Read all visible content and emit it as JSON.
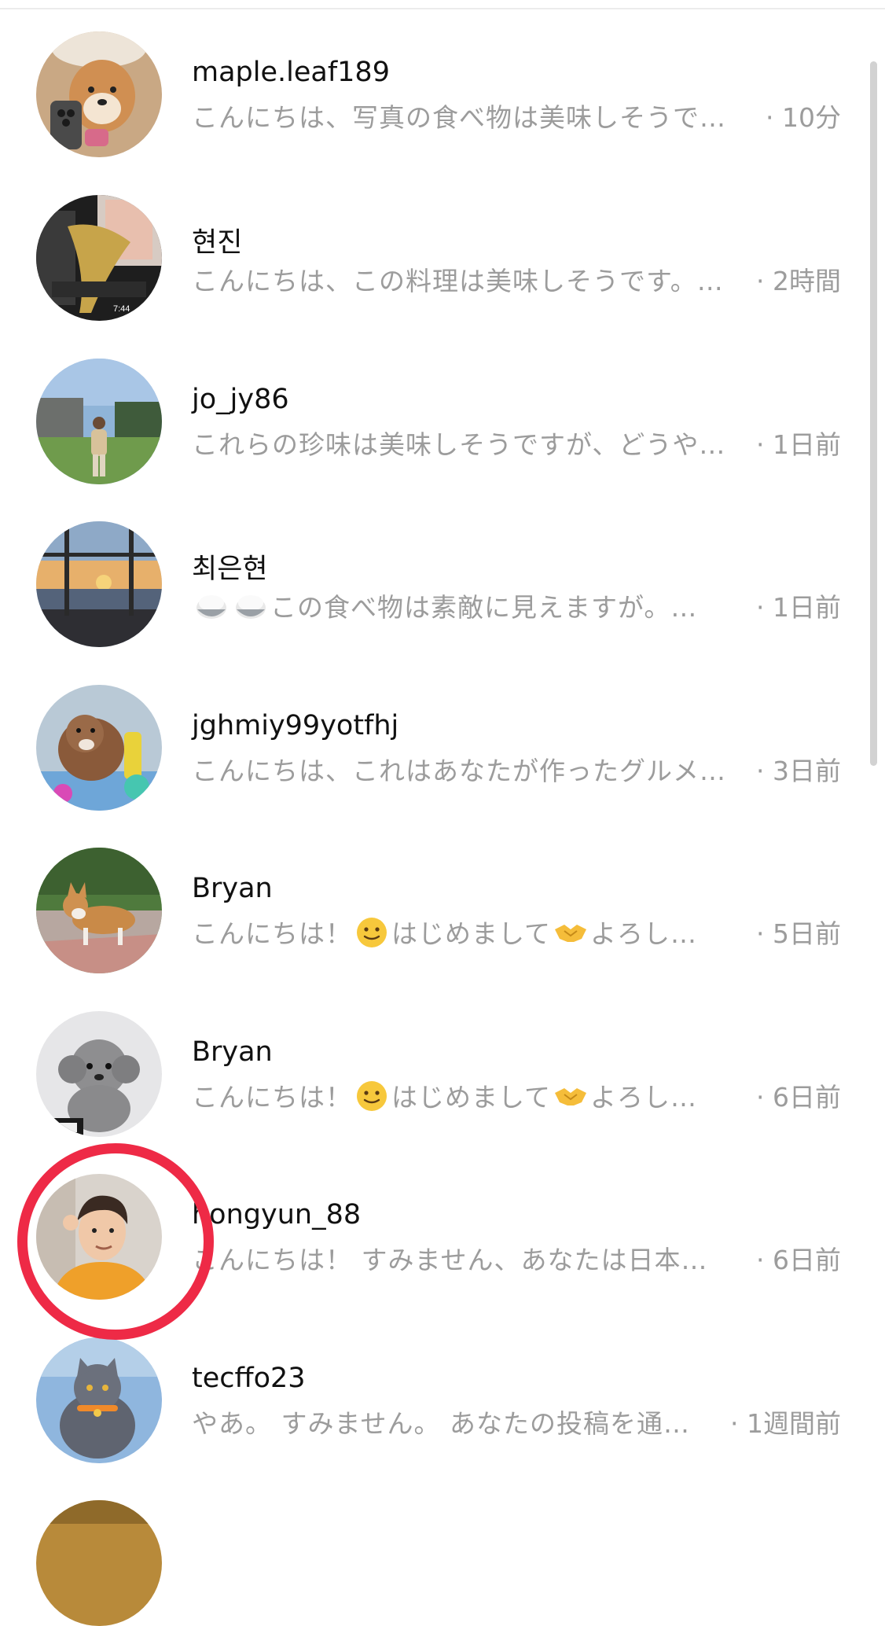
{
  "conversations": [
    {
      "username": "maple.leaf189",
      "preview": "こんにちは、写真の食べ物は美味しそうで…",
      "time": "· 10分",
      "avatar_icon": "shiba-dog-with-phone-avatar"
    },
    {
      "username": "현진",
      "preview": "こんにちは、この料理は美味しそうです。…",
      "time": "· 2時間",
      "avatar_icon": "video-thumbnail-avatar"
    },
    {
      "username": "jo_jy86",
      "preview": "これらの珍味は美味しそうですが、どうや…",
      "time": "· 1日前",
      "avatar_icon": "man-on-lawn-avatar"
    },
    {
      "username": "최은현",
      "preview_emoji": "rice-bowl-icon",
      "preview": "この食べ物は素敵に見えますが。…",
      "time": "· 1日前",
      "avatar_icon": "sunset-window-avatar"
    },
    {
      "username": "jghmiy99yotfhj",
      "preview": "こんにちは、これはあなたが作ったグルメ…",
      "time": "· 3日前",
      "avatar_icon": "brown-dog-toys-avatar"
    },
    {
      "username": "Bryan",
      "preview_a": "こんにちは！",
      "preview_b": "はじめまして",
      "preview_c": "よろし…",
      "time": "· 5日前",
      "avatar_icon": "corgi-avatar"
    },
    {
      "username": "Bryan",
      "preview_a": "こんにちは！",
      "preview_b": "はじめまして",
      "preview_c": "よろし…",
      "time": "· 6日前",
      "avatar_icon": "grey-poodle-avatar"
    },
    {
      "username": "hongyun_88",
      "preview": "こんにちは！ すみません、あなたは日本…",
      "time": "· 6日前",
      "avatar_icon": "man-yellow-shirt-avatar"
    },
    {
      "username": "tecffo23",
      "preview": "やあ。 すみません。 あなたの投稿を通…",
      "time": "· 1週間前",
      "avatar_icon": "grey-cat-avatar"
    }
  ],
  "colors": {
    "highlight_ring": "#ee2a46",
    "username": "#111111",
    "secondary_text": "#9c9c9c"
  }
}
